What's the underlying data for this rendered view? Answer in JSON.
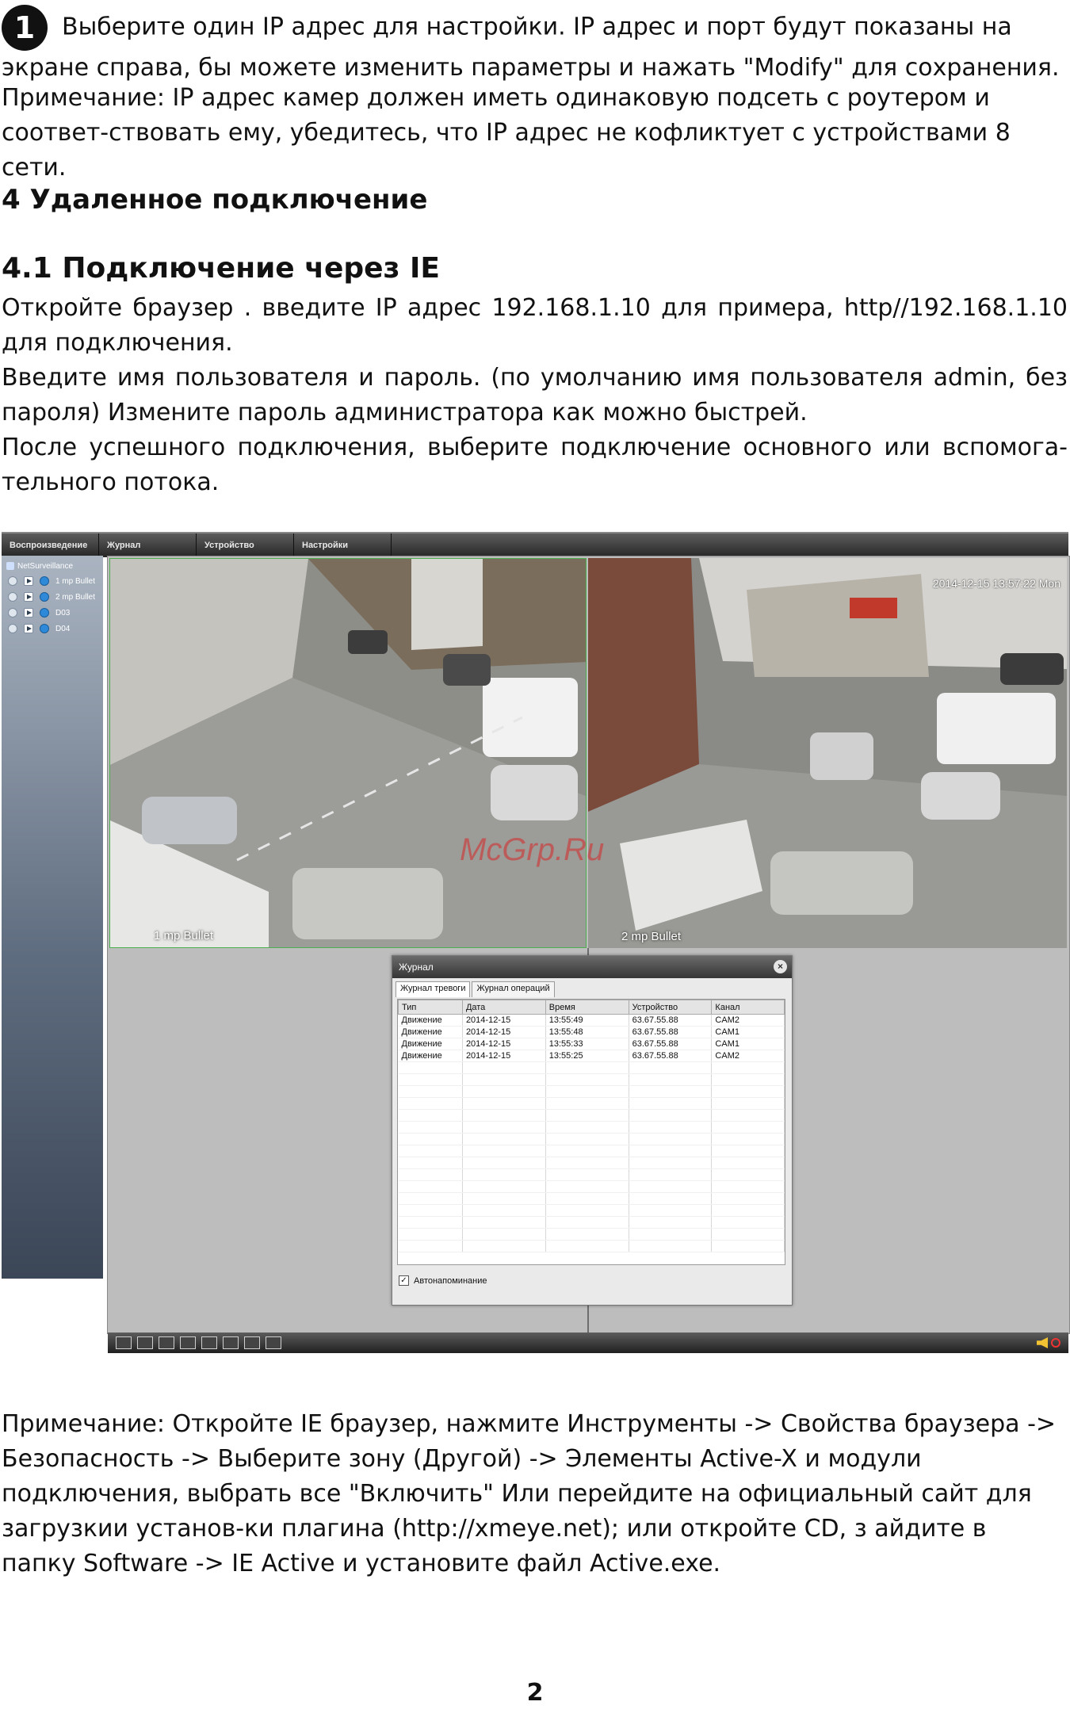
{
  "intro": {
    "step": "1",
    "lines": [
      "Выберите один IP адрес для настройки. IP адрес и порт будут показаны на экране справа, бы можете изменить параметры и нажать \"Modify\" для сохранения.",
      "Примечание: IP адрес камер должен иметь одинаковую подсеть с роутером и соответ-ствовать ему, убедитесь, что IP адрес не кофликтует с устройствами 8 сети."
    ]
  },
  "section": {
    "title": "4 Удаленное подключение"
  },
  "subsection": {
    "number": "4.1",
    "title": "Подключение через IE",
    "paragraphs": [
      "Откройте браузер . введите IP адрес 192.168.1.10 для примера, http//192.168.1.10 для подключения.",
      "Введите имя пользователя и пароль. (по умолчанию имя пользователя admin, без пароля)  Измените пароль администратора как можно быстрей.",
      "После успешного подключения, выберите подключение основного или вспомога-тельного потока."
    ]
  },
  "app": {
    "menu": [
      "Воспроизведение",
      "Журнал",
      "Устройство",
      "Настройки"
    ],
    "tree_root": "NetSurveillance",
    "channels": [
      "1 mp Bullet",
      "2 mp Bullet",
      "D03",
      "D04"
    ],
    "cameras": [
      {
        "name": "1 mp Bullet",
        "timestamp": ""
      },
      {
        "name": "2 mp Bullet",
        "timestamp": "2014-12-15 13:57:22 Mon"
      }
    ],
    "watermark": "McGrp.Ru",
    "dialog": {
      "title": "Журнал",
      "tabs": [
        "Журнал тревоги",
        "Журнал операций"
      ],
      "columns": [
        "Тип",
        "Дата",
        "Время",
        "Устройство",
        "Канал"
      ],
      "rows": [
        [
          "Движение",
          "2014-12-15",
          "13:55:49",
          "63.67.55.88",
          "CAM2"
        ],
        [
          "Движение",
          "2014-12-15",
          "13:55:48",
          "63.67.55.88",
          "CAM1"
        ],
        [
          "Движение",
          "2014-12-15",
          "13:55:33",
          "63.67.55.88",
          "CAM1"
        ],
        [
          "Движение",
          "2014-12-15",
          "13:55:25",
          "63.67.55.88",
          "CAM2"
        ]
      ],
      "auto_remind": "Автонапоминание"
    }
  },
  "note": "Примечание: Откройте IE браузер, нажмите Инструменты -> Свойства браузера -> Безопасность -> Выберите зону (Другой) -> Элементы Active-X и модули подключения, выбрать все \"Включить\" Или перейдите на официальный сайт для загрузкии установ-ки плагина (http://xmeye.net); или откройте CD, з айдите в папку Software -> IE Active и установите файл Active.exe.",
  "page_number": "2"
}
